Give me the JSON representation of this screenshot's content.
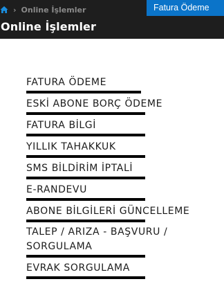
{
  "breadcrumb": {
    "home_icon": "home-icon",
    "separator": "›",
    "current": "Online İşlemler"
  },
  "quick_tab": {
    "label": "Fatura Ödeme"
  },
  "page": {
    "title": "Online İşlemler"
  },
  "menu": {
    "items": [
      {
        "label": "FATURA ÖDEME"
      },
      {
        "label": "ESKİ ABONE BORÇ ÖDEME"
      },
      {
        "label": "FATURA BİLGİ"
      },
      {
        "label": "YILLIK TAHAKKUK"
      },
      {
        "label": "SMS BİLDİRİM İPTALİ"
      },
      {
        "label": "E-RANDEVU"
      },
      {
        "label": "ABONE BİLGİLERİ GÜNCELLEME"
      },
      {
        "label": "TALEP / ARIZA - BAŞVURU / SORGULAMA"
      },
      {
        "label": "EVRAK SORGULAMA"
      }
    ]
  },
  "colors": {
    "topbar_bg": "#1e1e1e",
    "accent_blue": "#0b74c9",
    "underline": "#000000"
  }
}
